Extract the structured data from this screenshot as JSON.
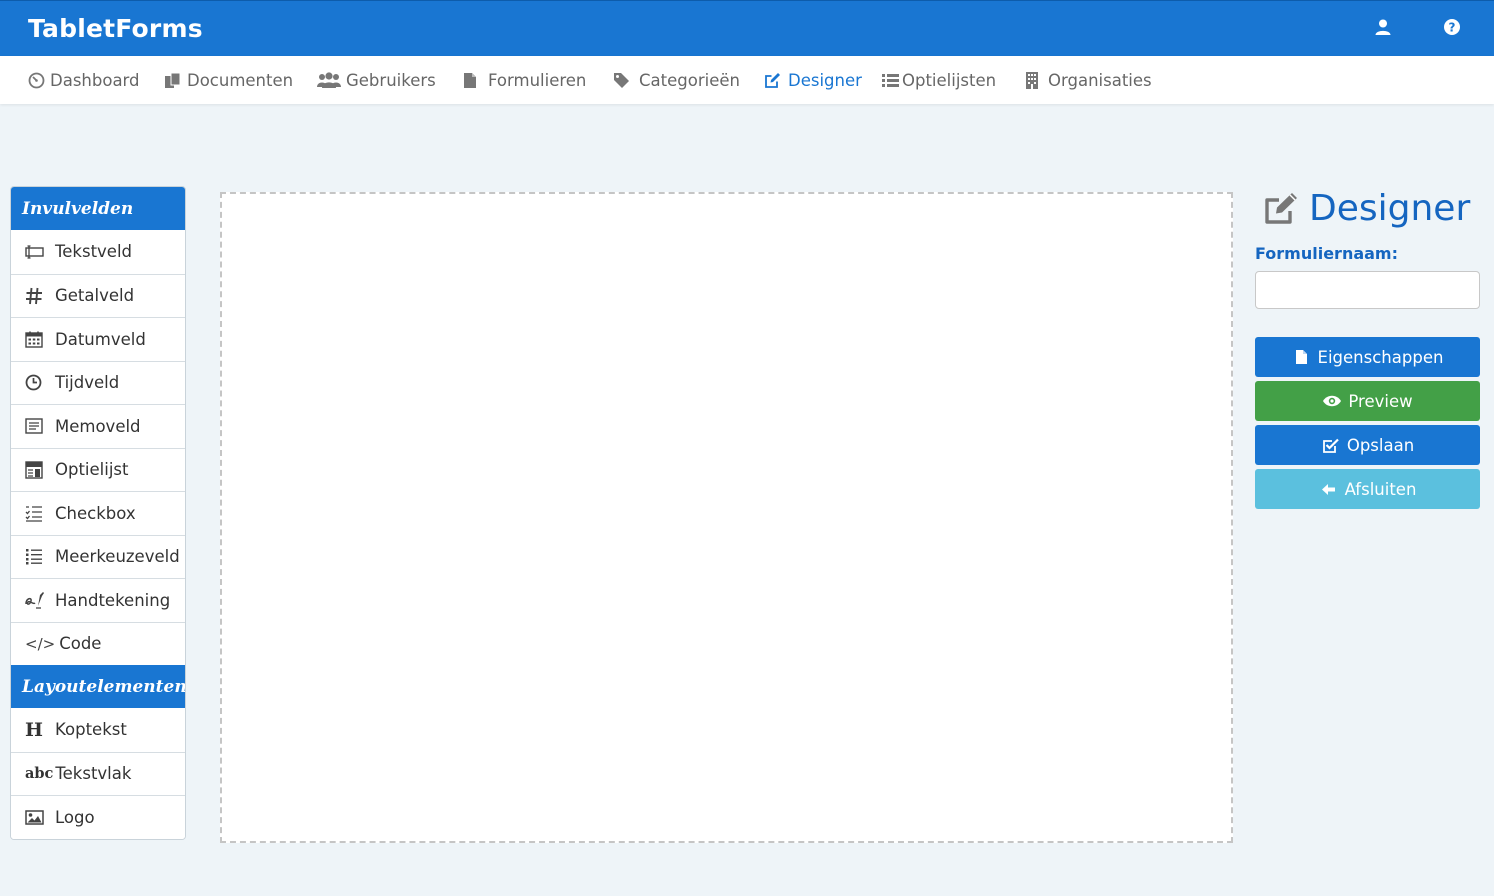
{
  "app": {
    "brand": "TabletForms"
  },
  "header_icons": [
    {
      "name": "user-icon"
    },
    {
      "name": "help-icon"
    }
  ],
  "nav": {
    "active": "Designer",
    "items": [
      {
        "label": "Dashboard",
        "icon": "dashboard-icon"
      },
      {
        "label": "Documenten",
        "icon": "documents-icon"
      },
      {
        "label": "Gebruikers",
        "icon": "users-icon"
      },
      {
        "label": "Formulieren",
        "icon": "file-icon"
      },
      {
        "label": "Categorieën",
        "icon": "tag-icon"
      },
      {
        "label": "Designer",
        "icon": "edit-icon"
      },
      {
        "label": "Optielijsten",
        "icon": "list-icon"
      },
      {
        "label": "Organisaties",
        "icon": "building-icon"
      }
    ]
  },
  "toolbox": {
    "fields_header": "Invulvelden",
    "fields": [
      {
        "label": "Tekstveld",
        "icon": "textfield-icon"
      },
      {
        "label": "Getalveld",
        "icon": "hash-icon"
      },
      {
        "label": "Datumveld",
        "icon": "calendar-icon"
      },
      {
        "label": "Tijdveld",
        "icon": "clock-icon"
      },
      {
        "label": "Memoveld",
        "icon": "memo-icon"
      },
      {
        "label": "Optielijst",
        "icon": "dropdown-icon"
      },
      {
        "label": "Checkbox",
        "icon": "checklist-icon"
      },
      {
        "label": "Meerkeuzeveld",
        "icon": "multichoice-icon"
      },
      {
        "label": "Handtekening",
        "icon": "signature-icon"
      },
      {
        "label": "Code",
        "icon": "code-icon",
        "glyph": "</>"
      }
    ],
    "layout_header": "Layoutelementen",
    "layout": [
      {
        "label": "Koptekst",
        "icon": "heading-icon",
        "glyph": "H"
      },
      {
        "label": "Tekstvlak",
        "icon": "textblock-icon",
        "glyph": "abc"
      },
      {
        "label": "Logo",
        "icon": "image-icon"
      }
    ]
  },
  "designer": {
    "title": "Designer",
    "form_name_label": "Formuliernaam:",
    "form_name_value": "",
    "buttons": {
      "properties": "Eigenschappen",
      "preview": "Preview",
      "save": "Opslaan",
      "close": "Afsluiten"
    }
  },
  "colors": {
    "primary": "#1976d2",
    "success": "#43a047",
    "info": "#5bc0de",
    "background": "#eef4f8",
    "title": "#1565c0"
  }
}
